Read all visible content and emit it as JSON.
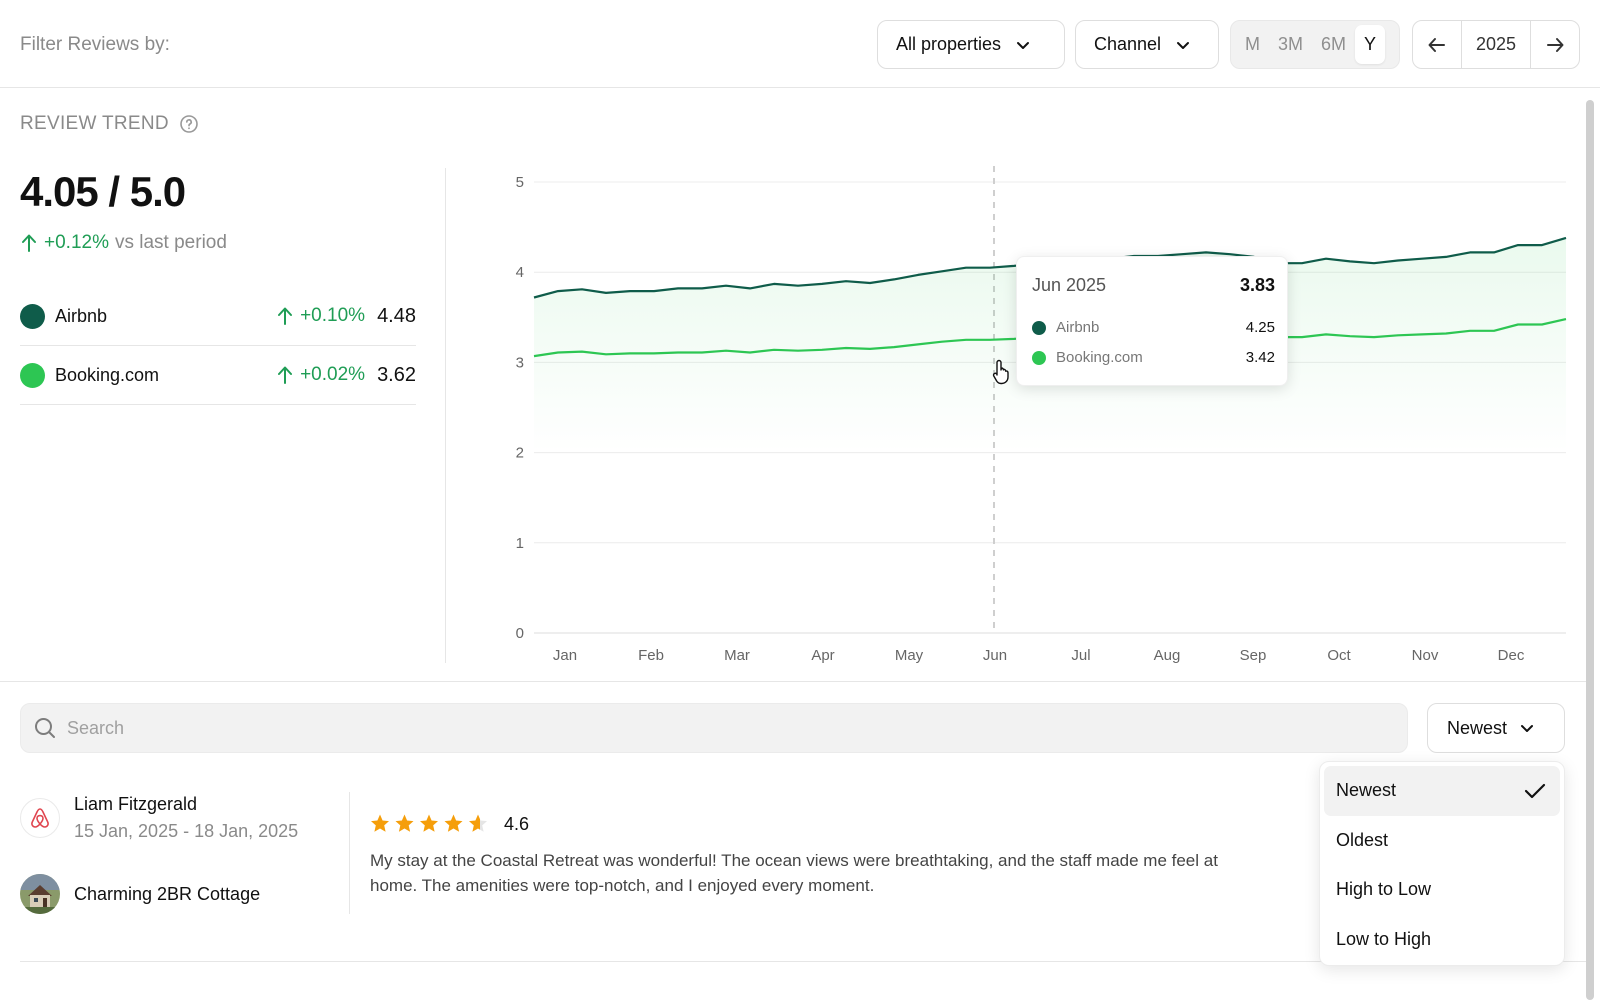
{
  "filter_bar": {
    "label": "Filter Reviews by:",
    "properties_dropdown": "All properties",
    "channel_dropdown": "Channel",
    "periods": [
      "M",
      "3M",
      "6M",
      "Y"
    ],
    "active_period": "Y",
    "year": "2025"
  },
  "trend": {
    "title": "REVIEW TREND",
    "score": "4.05 / 5.0",
    "change": "+0.12%",
    "change_suffix": "vs last period",
    "channels": [
      {
        "name": "Airbnb",
        "change": "+0.10%",
        "value": "4.48",
        "color": "#0f5c4a"
      },
      {
        "name": "Booking.com",
        "change": "+0.02%",
        "value": "3.62",
        "color": "#2dc653"
      }
    ]
  },
  "chart_data": {
    "type": "area",
    "months": [
      "Jan",
      "Feb",
      "Mar",
      "Apr",
      "May",
      "Jun",
      "Jul",
      "Aug",
      "Sep",
      "Oct",
      "Nov",
      "Dec"
    ],
    "y_ticks": [
      0,
      1,
      2,
      3,
      4,
      5
    ],
    "ylim": [
      0,
      5
    ],
    "grid": true,
    "series": [
      {
        "name": "Airbnb",
        "color": "#0f5c4a",
        "values": [
          3.72,
          3.79,
          3.81,
          3.77,
          3.79,
          3.79,
          3.82,
          3.82,
          3.85,
          3.82,
          3.87,
          3.85,
          3.87,
          3.9,
          3.88,
          3.92,
          3.97,
          4.01,
          4.05,
          4.05,
          4.07,
          4.1,
          4.13,
          4.15,
          4.15,
          4.18,
          4.18,
          4.2,
          4.22,
          4.2,
          4.17,
          4.1,
          4.1,
          4.15,
          4.12,
          4.1,
          4.13,
          4.15,
          4.17,
          4.22,
          4.22,
          4.3,
          4.3,
          4.38
        ]
      },
      {
        "name": "Booking.com",
        "color": "#2dc653",
        "values": [
          3.07,
          3.11,
          3.12,
          3.09,
          3.1,
          3.1,
          3.11,
          3.11,
          3.13,
          3.11,
          3.14,
          3.13,
          3.14,
          3.16,
          3.15,
          3.17,
          3.2,
          3.23,
          3.25,
          3.25,
          3.26,
          3.28,
          3.3,
          3.31,
          3.31,
          3.33,
          3.33,
          3.34,
          3.35,
          3.34,
          3.32,
          3.28,
          3.28,
          3.31,
          3.29,
          3.28,
          3.3,
          3.31,
          3.32,
          3.35,
          3.35,
          3.42,
          3.42,
          3.48
        ]
      }
    ],
    "hover_month": "Jun"
  },
  "tooltip": {
    "month": "Jun 2025",
    "total": "3.83",
    "rows": [
      {
        "name": "Airbnb",
        "value": "4.25",
        "color": "#0f5c4a"
      },
      {
        "name": "Booking.com",
        "value": "3.42",
        "color": "#2dc653"
      }
    ]
  },
  "search": {
    "placeholder": "Search"
  },
  "sort": {
    "selected": "Newest",
    "options": [
      "Newest",
      "Oldest",
      "High to Low",
      "Low to High"
    ]
  },
  "review": {
    "reviewer": "Liam Fitzgerald",
    "dates": "15 Jan, 2025 - 18 Jan, 2025",
    "property": "Charming 2BR Cottage",
    "rating": 4.6,
    "rating_text": "4.6",
    "text": "My stay at the Coastal Retreat was wonderful! The ocean views were breathtaking, and the staff made me feel at home. The amenities were top-notch, and I enjoyed every moment."
  }
}
